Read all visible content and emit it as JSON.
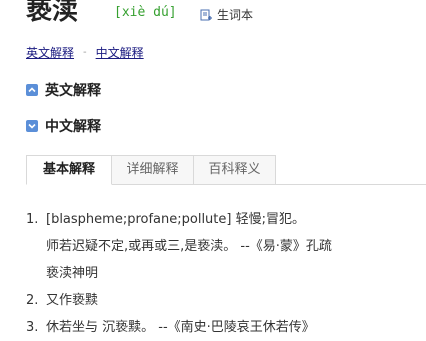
{
  "header": {
    "word": "亵渎",
    "pinyin": "[xiè dú]",
    "vocab_label": "生词本",
    "vocab_icon": "notebook-add-icon"
  },
  "breadcrumb": {
    "items": [
      "英文解释",
      "中文解释"
    ],
    "separator": "-"
  },
  "sections": {
    "english": {
      "label": "英文解释",
      "icon": "expand-up-icon"
    },
    "chinese": {
      "label": "中文解释",
      "icon": "expand-down-icon"
    }
  },
  "tabs": [
    {
      "label": "基本解释",
      "active": true
    },
    {
      "label": "详细解释",
      "active": false
    },
    {
      "label": "百科释义",
      "active": false
    }
  ],
  "definitions": [
    {
      "num": "1.",
      "lines": [
        "[blaspheme;profane;pollute] 轻慢;冒犯。",
        "师若迟疑不定,或再或三,是亵渎。 --《易·蒙》孔疏",
        "亵渎神明"
      ]
    },
    {
      "num": "2.",
      "lines": [
        "又作亵黩"
      ]
    },
    {
      "num": "3.",
      "lines": [
        "休若坐与 沉亵黩。 --《南史·巴陵哀王休若传》"
      ]
    }
  ],
  "colors": {
    "pinyin": "#35a02f",
    "link": "#1a1a80",
    "toggle": "#5b8fd8",
    "tab_border": "#d9d9d9"
  }
}
